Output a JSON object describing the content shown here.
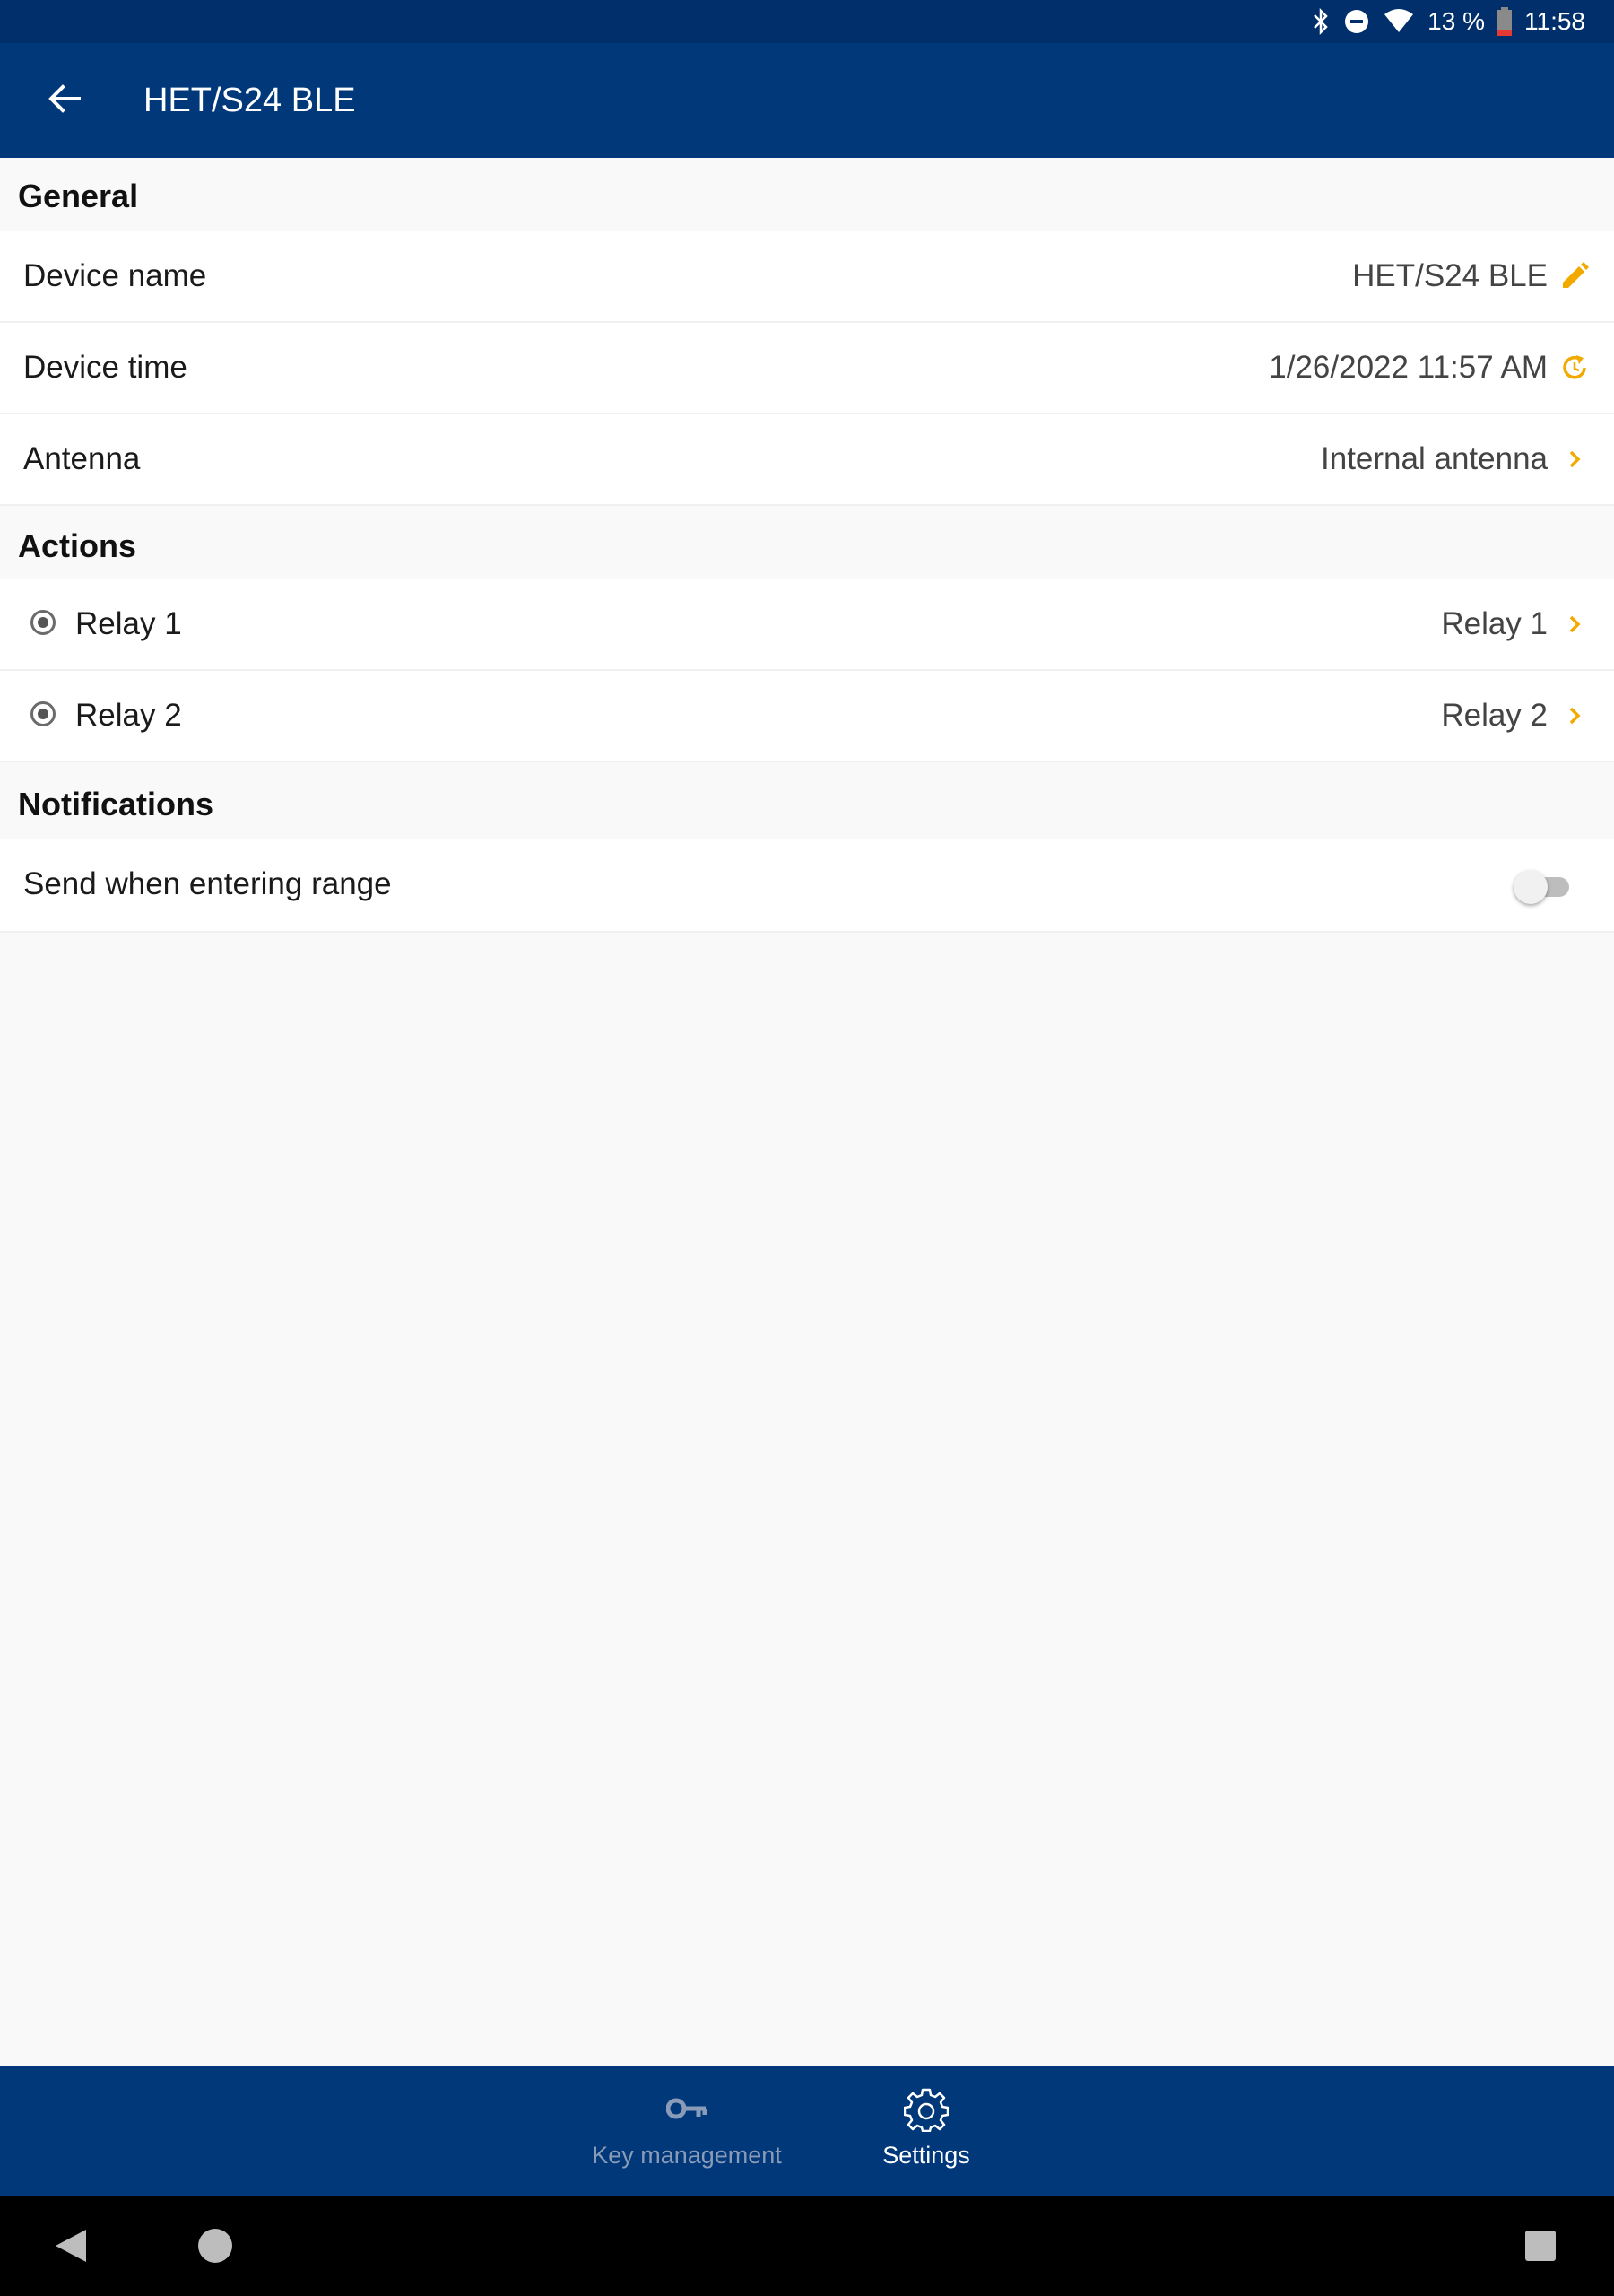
{
  "status_bar": {
    "battery": "13 %",
    "time": "11:58",
    "icons": [
      "bluetooth-icon",
      "do-not-disturb-icon",
      "wifi-icon",
      "battery-low-icon"
    ]
  },
  "app_bar": {
    "title": "HET/S24 BLE",
    "back_icon": "arrow-back-icon"
  },
  "sections": {
    "general": {
      "header": "General",
      "device_name": {
        "label": "Device name",
        "value": "HET/S24 BLE",
        "icon": "pencil-icon"
      },
      "device_time": {
        "label": "Device time",
        "value": "1/26/2022 11:57 AM",
        "icon": "sync-icon"
      },
      "antenna": {
        "label": "Antenna",
        "value": "Internal antenna",
        "icon": "chevron-right-icon"
      }
    },
    "actions": {
      "header": "Actions",
      "relay1": {
        "label": "Relay 1",
        "value": "Relay 1",
        "icon": "chevron-right-icon"
      },
      "relay2": {
        "label": "Relay 2",
        "value": "Relay 2",
        "icon": "chevron-right-icon"
      }
    },
    "notifications": {
      "header": "Notifications",
      "send_entering_range": {
        "label": "Send when entering range",
        "enabled": false
      }
    }
  },
  "bottom_nav": {
    "key_management": {
      "label": "Key management",
      "icon": "key-icon",
      "active": false
    },
    "settings": {
      "label": "Settings",
      "icon": "gear-icon",
      "active": true
    }
  },
  "colors": {
    "primary": "#00387a",
    "accent": "#f2a900",
    "background": "#f9f9f9",
    "inactive_nav": "#8a9bb8"
  }
}
